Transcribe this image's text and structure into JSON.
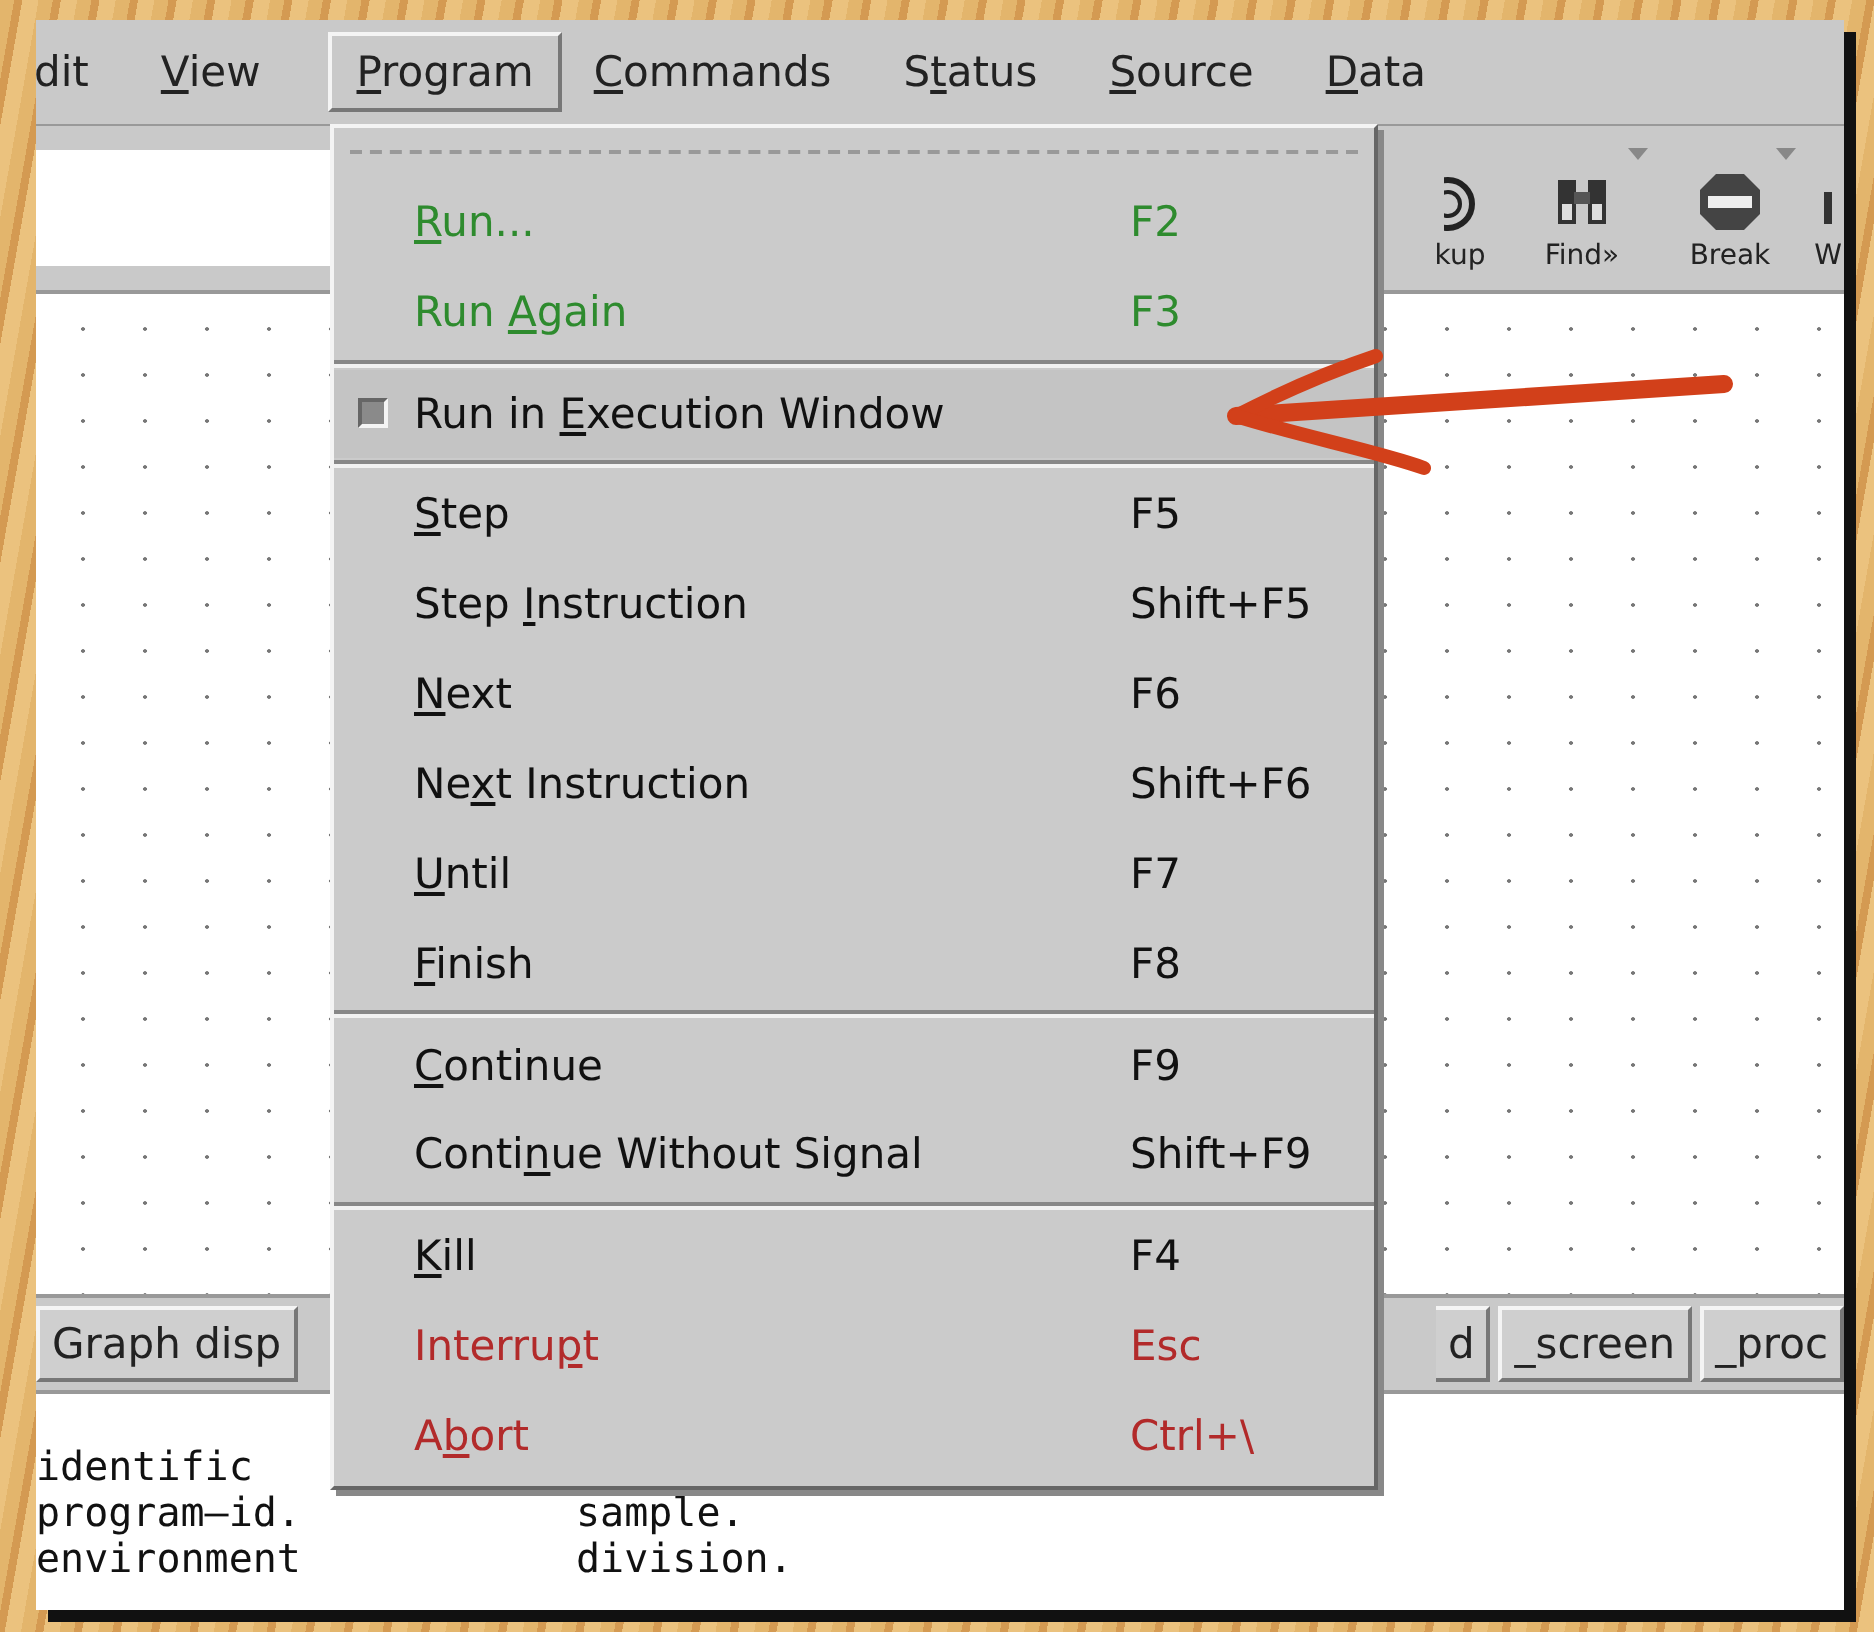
{
  "menubar": [
    {
      "label": {
        "post": "dit"
      },
      "selected": false
    },
    {
      "label": {
        "key": "V",
        "post": "iew"
      },
      "selected": false
    },
    {
      "label": {
        "key": "P",
        "post": "rogram"
      },
      "selected": true
    },
    {
      "label": {
        "key": "C",
        "post": "ommands"
      },
      "selected": false
    },
    {
      "label": {
        "pre": "S",
        "key": "t",
        "post": "atus"
      },
      "selected": false
    },
    {
      "label": {
        "key": "S",
        "post": "ource"
      },
      "selected": false
    },
    {
      "label": {
        "key": "D",
        "post": "ata"
      },
      "selected": false
    }
  ],
  "toolbar": [
    {
      "kind": "target",
      "label": "kup",
      "caret": false
    },
    {
      "kind": "binoculars",
      "label": "Find»",
      "caret": true
    },
    {
      "kind": "stop",
      "label": "Break",
      "caret": true
    },
    {
      "kind": "partial",
      "label": "W",
      "caret": false
    }
  ],
  "graph_buttons": [
    "Graph disp",
    "d",
    "_screen",
    "_proc"
  ],
  "source_lines": [
    [
      "identific"
    ],
    [
      "program–id.",
      "sample."
    ],
    [
      "environment",
      "division."
    ]
  ],
  "program_menu": [
    {
      "kind": "tearoff"
    },
    {
      "kind": "item",
      "label": {
        "key": "R",
        "post": "un..."
      },
      "shortcut": "F2",
      "color": "#2e8b2e",
      "selected": false
    },
    {
      "kind": "item",
      "label": {
        "pre": "Run ",
        "key": "A",
        "post": "gain"
      },
      "shortcut": "F3",
      "color": "#2e8b2e",
      "selected": false
    },
    {
      "kind": "separator"
    },
    {
      "kind": "check",
      "label": {
        "pre": "Run in ",
        "key": "E",
        "post": "xecution Window"
      },
      "checked": true,
      "selected": true
    },
    {
      "kind": "separator"
    },
    {
      "kind": "item",
      "label": {
        "key": "S",
        "post": "tep"
      },
      "shortcut": "F5",
      "color": "#111111",
      "selected": false
    },
    {
      "kind": "item",
      "label": {
        "pre": "Step ",
        "key": "I",
        "post": "nstruction"
      },
      "shortcut": "Shift+F5",
      "color": "#111111",
      "selected": false
    },
    {
      "kind": "item",
      "label": {
        "key": "N",
        "post": "ext"
      },
      "shortcut": "F6",
      "color": "#111111",
      "selected": false
    },
    {
      "kind": "item",
      "label": {
        "pre": "Ne",
        "key": "x",
        "post": "t Instruction"
      },
      "shortcut": "Shift+F6",
      "color": "#111111",
      "selected": false
    },
    {
      "kind": "item",
      "label": {
        "key": "U",
        "post": "ntil"
      },
      "shortcut": "F7",
      "color": "#111111",
      "selected": false
    },
    {
      "kind": "item",
      "label": {
        "key": "F",
        "post": "inish"
      },
      "shortcut": "F8",
      "color": "#111111",
      "selected": false
    },
    {
      "kind": "separator"
    },
    {
      "kind": "item",
      "label": {
        "key": "C",
        "post": "ontinue"
      },
      "shortcut": "F9",
      "color": "#111111",
      "selected": false
    },
    {
      "kind": "item",
      "label": {
        "pre": "Conti",
        "key": "n",
        "post": "ue Without Signal"
      },
      "shortcut": "Shift+F9",
      "color": "#111111",
      "selected": false
    },
    {
      "kind": "separator"
    },
    {
      "kind": "item",
      "label": {
        "key": "K",
        "post": "ill"
      },
      "shortcut": "F4",
      "color": "#111111",
      "selected": false
    },
    {
      "kind": "item",
      "label": {
        "pre": "Interru",
        "key": "p",
        "post": "t"
      },
      "shortcut": "Esc",
      "color": "#b22a2a",
      "selected": false
    },
    {
      "kind": "item",
      "label": {
        "pre": "A",
        "key": "b",
        "post": "ort"
      },
      "shortcut": "Ctrl+\\",
      "color": "#b22a2a",
      "selected": false
    }
  ],
  "annotation": {
    "kind": "arrow"
  }
}
